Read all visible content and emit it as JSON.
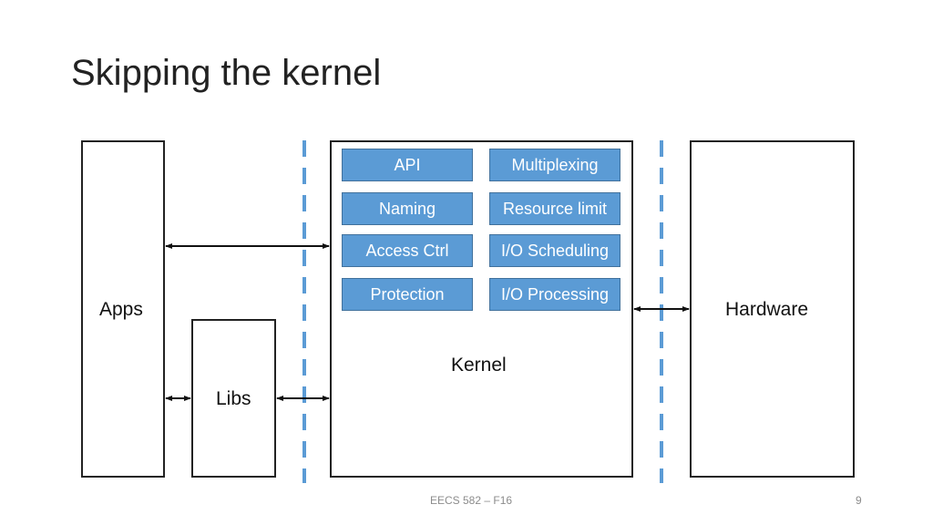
{
  "slide": {
    "title": "Skipping the kernel",
    "footer_text": "EECS 582 – F16",
    "page_number": "9"
  },
  "diagram": {
    "apps_label": "Apps",
    "libs_label": "Libs",
    "kernel_label": "Kernel",
    "hardware_label": "Hardware",
    "kernel_functions": [
      "API",
      "Multiplexing",
      "Naming",
      "Resource limit",
      "Access Ctrl",
      "I/O Scheduling",
      "Protection",
      "I/O Processing"
    ],
    "colors": {
      "function_fill": "#5b9bd5",
      "boundary_dash": "#5b9bd5",
      "outline": "#222222"
    }
  }
}
